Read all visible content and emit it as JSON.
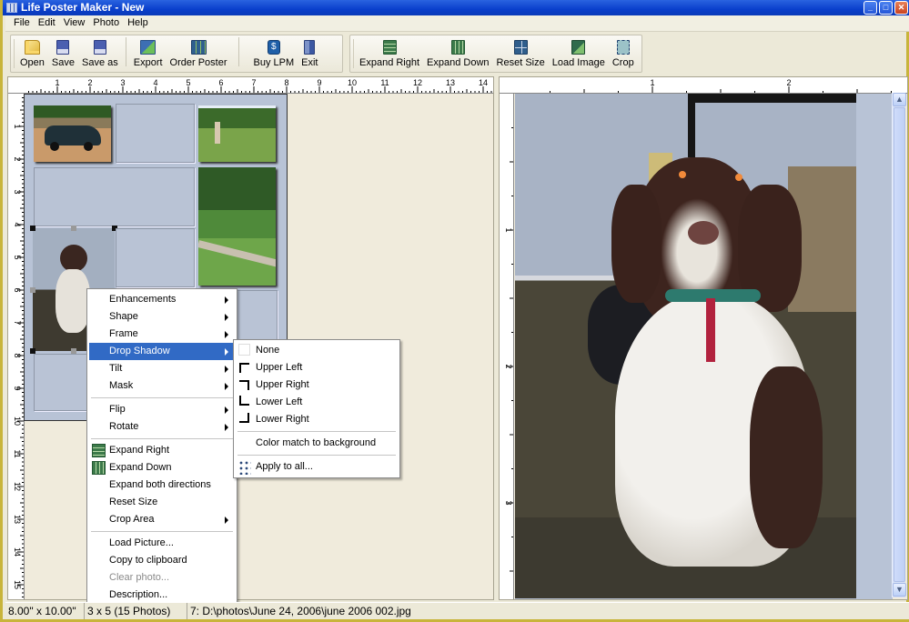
{
  "window": {
    "title": "Life Poster Maker - New",
    "controls": [
      "minimize",
      "maximize",
      "close"
    ]
  },
  "menubar": [
    "File",
    "Edit",
    "View",
    "Photo",
    "Help"
  ],
  "toolbar": {
    "group1": [
      {
        "label": "Open",
        "icon": "folder-open-icon"
      },
      {
        "label": "Save",
        "icon": "floppy-disk-icon"
      },
      {
        "label": "Save as",
        "icon": "floppy-disk-save-as-icon"
      },
      {
        "label": "Export",
        "icon": "export-icon"
      },
      {
        "label": "Order Poster",
        "icon": "order-poster-icon"
      },
      {
        "label": "Buy LPM",
        "icon": "dollar-icon"
      },
      {
        "label": "Exit",
        "icon": "exit-door-icon"
      }
    ],
    "group2": [
      {
        "label": "Expand Right",
        "icon": "expand-right-icon"
      },
      {
        "label": "Expand Down",
        "icon": "expand-down-icon"
      },
      {
        "label": "Reset Size",
        "icon": "reset-size-icon"
      },
      {
        "label": "Load Image",
        "icon": "load-image-icon"
      },
      {
        "label": "Crop",
        "icon": "crop-icon"
      }
    ]
  },
  "left_ruler": {
    "h_ticks": [
      "1",
      "2",
      "3",
      "4",
      "5",
      "6",
      "7",
      "8",
      "9",
      "10",
      "11",
      "12",
      "13",
      "14"
    ],
    "v_ticks": [
      "1",
      "2",
      "3",
      "4",
      "5",
      "6",
      "7",
      "8",
      "9",
      "10",
      "11",
      "12",
      "13",
      "14",
      "15"
    ]
  },
  "right_ruler": {
    "h_ticks": [
      "1",
      "2"
    ],
    "v_ticks": [
      "1",
      "2",
      "3"
    ]
  },
  "context_menu": {
    "items": [
      {
        "label": "Enhancements",
        "submenu": true
      },
      {
        "label": "Shape",
        "submenu": true
      },
      {
        "label": "Frame",
        "submenu": true
      },
      {
        "label": "Drop Shadow",
        "submenu": true,
        "highlighted": true
      },
      {
        "label": "Tilt",
        "submenu": true
      },
      {
        "label": "Mask",
        "submenu": true
      },
      {
        "separator": true
      },
      {
        "label": "Flip",
        "submenu": true
      },
      {
        "label": "Rotate",
        "submenu": true
      },
      {
        "separator": true
      },
      {
        "label": "Expand Right",
        "icon": "expand-right-icon"
      },
      {
        "label": "Expand Down",
        "icon": "expand-down-icon"
      },
      {
        "label": "Expand both directions"
      },
      {
        "label": "Reset Size"
      },
      {
        "label": "Crop Area",
        "submenu": true
      },
      {
        "separator": true
      },
      {
        "label": "Load Picture..."
      },
      {
        "label": "Copy to clipboard"
      },
      {
        "label": "Clear photo..."
      },
      {
        "label": "Description..."
      }
    ]
  },
  "shadow_submenu": {
    "items": [
      {
        "label": "None",
        "icon": "no-shadow-icon"
      },
      {
        "label": "Upper Left",
        "icon": "shadow-upper-left-icon"
      },
      {
        "label": "Upper Right",
        "icon": "shadow-upper-right-icon"
      },
      {
        "label": "Lower Left",
        "icon": "shadow-lower-left-icon"
      },
      {
        "label": "Lower Right",
        "icon": "shadow-lower-right-icon"
      },
      {
        "separator": true
      },
      {
        "label": "Color match to background"
      },
      {
        "separator": true
      },
      {
        "label": "Apply to all...",
        "icon": "apply-all-icon"
      }
    ]
  },
  "status": {
    "size": "8.00\" x 10.00\"",
    "layout": "3 x 5 (15 Photos)",
    "file": "7: D:\\photos\\June 24, 2006\\june 2006 002.jpg"
  },
  "colors": {
    "title_bar": "#0a3fcc",
    "highlight": "#316ac5",
    "poster_bg": "#b8c3d6",
    "window_bg": "#ece9d8"
  }
}
